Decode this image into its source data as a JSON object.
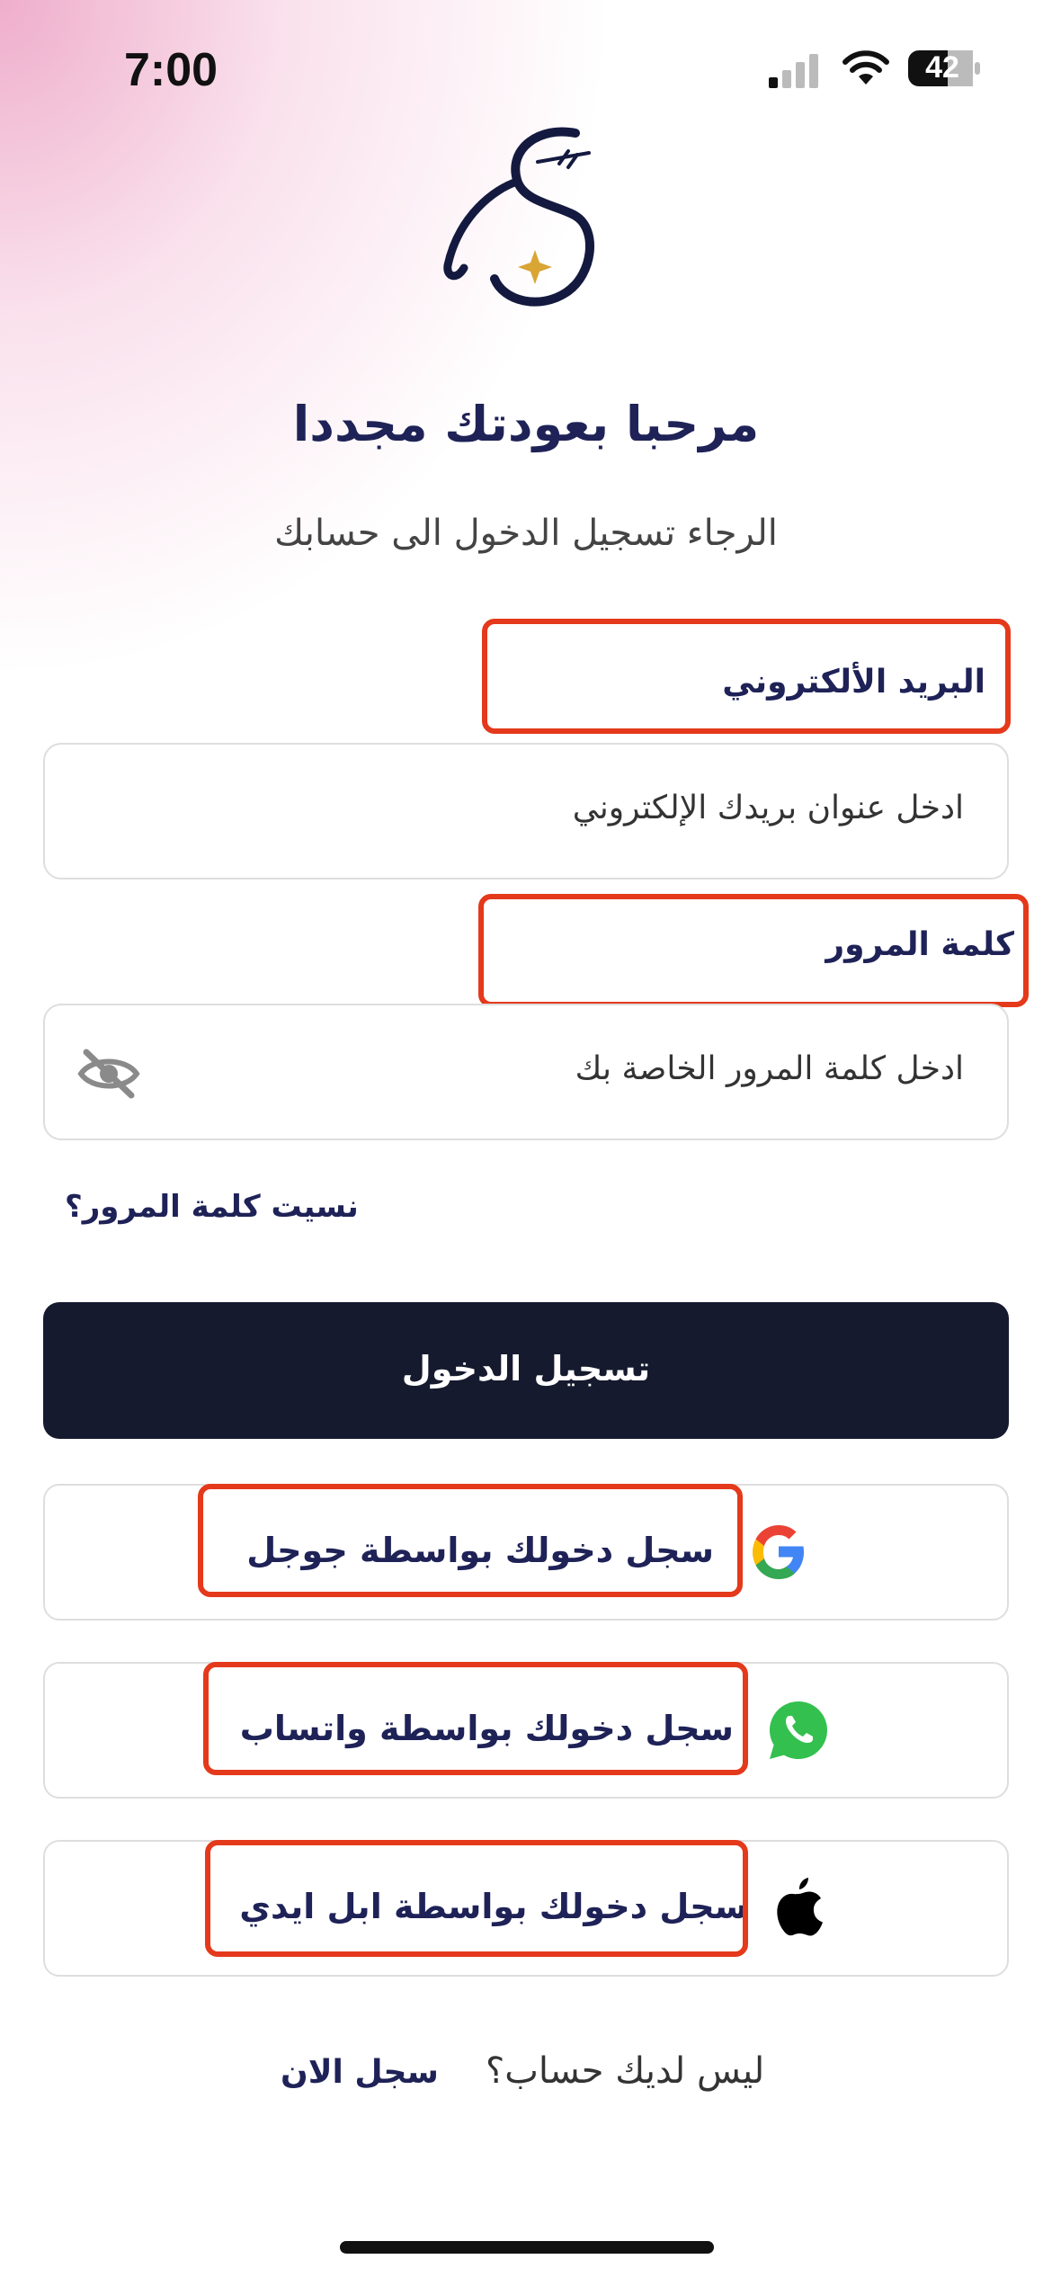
{
  "status_bar": {
    "time": "7:00",
    "battery_level": "42"
  },
  "header": {
    "title": "مرحبا بعودتك مجددا",
    "subtitle": "الرجاء تسجيل الدخول الى حسابك"
  },
  "form": {
    "email_label": "البريد الألكتروني",
    "email_placeholder": "ادخل عنوان بريدك الإلكتروني",
    "password_label": "كلمة المرور",
    "password_placeholder": "ادخل كلمة المرور الخاصة بك",
    "forgot_password": "نسيت كلمة المرور؟",
    "login_button": "تسجيل الدخول"
  },
  "social": {
    "google_label": "سجل دخولك بواسطة جوجل",
    "whatsapp_label": "سجل دخولك بواسطة واتساب",
    "apple_label": "سجل دخولك بواسطة ابل ايدي"
  },
  "footer": {
    "no_account": "ليس لديك حساب؟",
    "signup_link": "سجل الان"
  },
  "colors": {
    "primary_navy": "#1e2257",
    "button_dark": "#151a2e",
    "highlight_red": "#e4391b",
    "gradient_pink": "#eca0c3"
  },
  "icons": [
    "signal-icon",
    "wifi-icon",
    "battery-icon",
    "logo",
    "eye-off-icon",
    "google-icon",
    "whatsapp-icon",
    "apple-icon"
  ]
}
